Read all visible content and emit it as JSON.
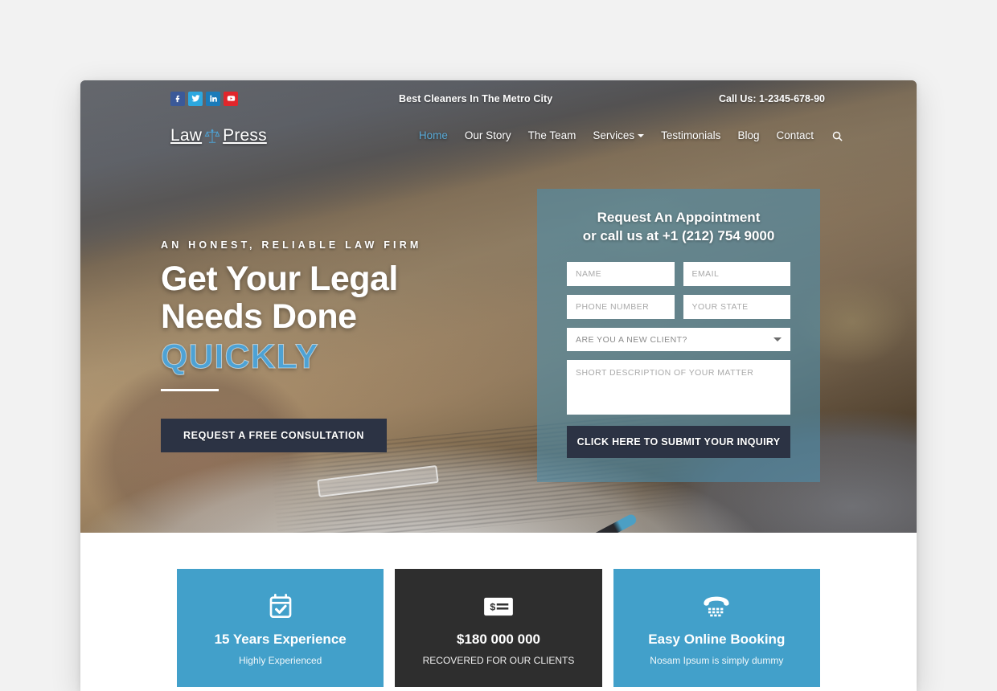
{
  "topbar": {
    "social": [
      {
        "name": "facebook",
        "label": "f",
        "color": "#3b5998"
      },
      {
        "name": "twitter",
        "label": "t",
        "color": "#2ca8e0"
      },
      {
        "name": "linkedin",
        "label": "in",
        "color": "#1b7bb9"
      },
      {
        "name": "youtube",
        "label": "yt",
        "color": "#e0262b"
      }
    ],
    "tagline": "Best Cleaners In The Metro City",
    "call_us": "Call Us: 1-2345-678-90"
  },
  "brand": {
    "name_left": "Law",
    "name_right": "Press",
    "icon": "scales-of-justice-icon"
  },
  "nav": {
    "items": [
      {
        "label": "Home",
        "active": true,
        "dropdown": false
      },
      {
        "label": "Our Story",
        "active": false,
        "dropdown": false
      },
      {
        "label": "The Team",
        "active": false,
        "dropdown": false
      },
      {
        "label": "Services",
        "active": false,
        "dropdown": true
      },
      {
        "label": "Testimonials",
        "active": false,
        "dropdown": false
      },
      {
        "label": "Blog",
        "active": false,
        "dropdown": false
      },
      {
        "label": "Contact",
        "active": false,
        "dropdown": false
      }
    ],
    "search_icon": "search-icon"
  },
  "hero": {
    "eyebrow": "AN HONEST, RELIABLE LAW FIRM",
    "headline_line1": "Get Your Legal",
    "headline_line2": "Needs Done",
    "rotating_word": "QUICKLY",
    "cta_label": "REQUEST A FREE CONSULTATION",
    "accent_color": "#4ea2d4",
    "cta_bg": "#2c3344"
  },
  "appointment": {
    "title_line1": "Request An Appointment",
    "title_line2": "or call us at +1 (212) 754 9000",
    "fields": {
      "name_placeholder": "NAME",
      "email_placeholder": "EMAIL",
      "phone_placeholder": "PHONE NUMBER",
      "state_placeholder": "YOUR STATE",
      "client_select_value": "ARE YOU A NEW CLIENT?",
      "description_placeholder": "SHORT DESCRIPTION OF YOUR MATTER"
    },
    "submit_label": "CLICK HERE TO SUBMIT YOUR INQUIRY",
    "panel_color": "#4e8caa"
  },
  "features": [
    {
      "icon": "calendar-check-icon",
      "title": "15 Years Experience",
      "subtitle": "Highly Experienced",
      "style": "blue",
      "color": "#42a0ca"
    },
    {
      "icon": "money-bill-icon",
      "title": "$180 000 000",
      "subtitle": "RECOVERED FOR OUR CLIENTS",
      "style": "dark",
      "color": "#2e2e2e"
    },
    {
      "icon": "telephone-icon",
      "title": "Easy Online Booking",
      "subtitle": "Nosam Ipsum is simply dummy",
      "style": "blue",
      "color": "#42a0ca"
    }
  ]
}
